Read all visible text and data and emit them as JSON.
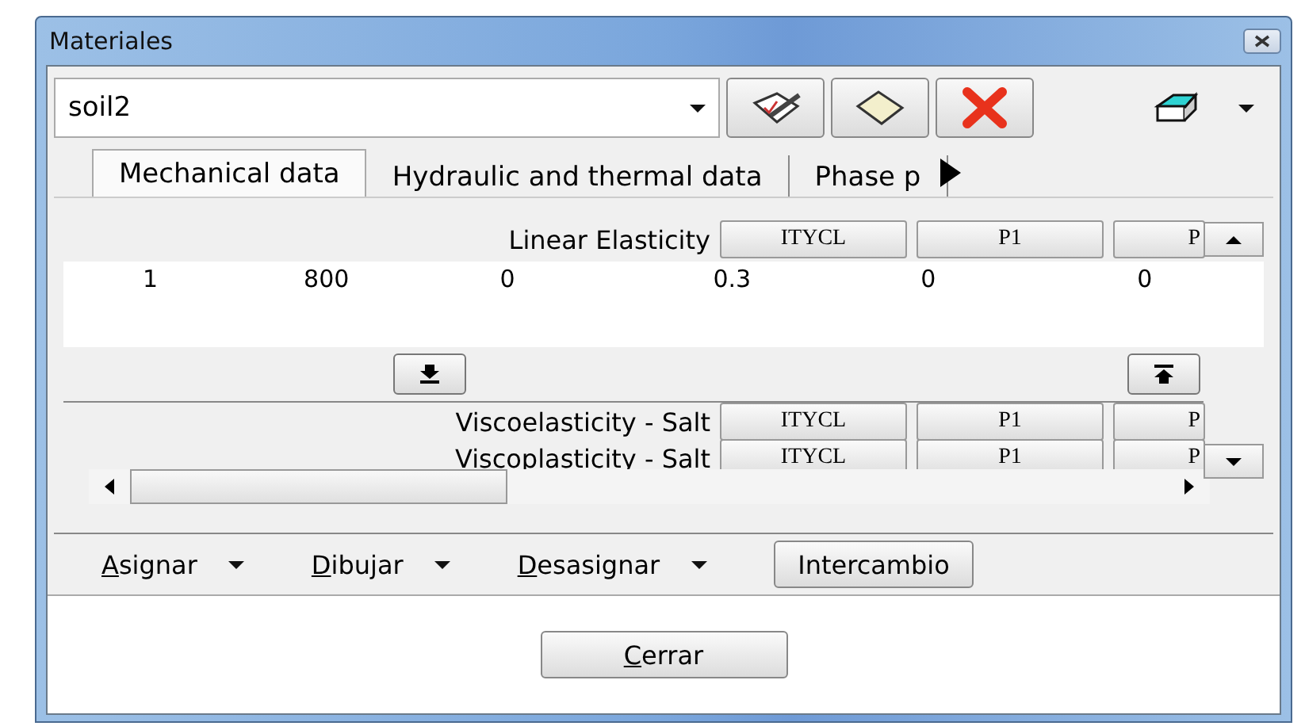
{
  "window": {
    "title": "Materiales"
  },
  "material": {
    "value": "soil2"
  },
  "tabs": [
    {
      "label": "Mechanical data",
      "selected": true
    },
    {
      "label": "Hydraulic and thermal data",
      "selected": false
    },
    {
      "label": "Phase p",
      "selected": false
    }
  ],
  "sections": [
    {
      "title": "Linear Elasticity",
      "columns": [
        "ITYCL",
        "P1",
        "P"
      ],
      "rows": [
        [
          "1",
          "800",
          "0",
          "0.3",
          "0",
          "0"
        ]
      ]
    },
    {
      "title": "Viscoelasticity - Salt",
      "columns": [
        "ITYCL",
        "P1",
        "P"
      ]
    },
    {
      "title": "Viscoplasticity - Salt",
      "columns": [
        "ITYCL",
        "P1",
        "P"
      ]
    }
  ],
  "actions": [
    {
      "label": "Asignar",
      "kind": "menu"
    },
    {
      "label": "Dibujar",
      "kind": "menu"
    },
    {
      "label": "Desasignar",
      "kind": "menu"
    },
    {
      "label": "Intercambio",
      "kind": "button"
    }
  ],
  "close_button": "Cerrar"
}
